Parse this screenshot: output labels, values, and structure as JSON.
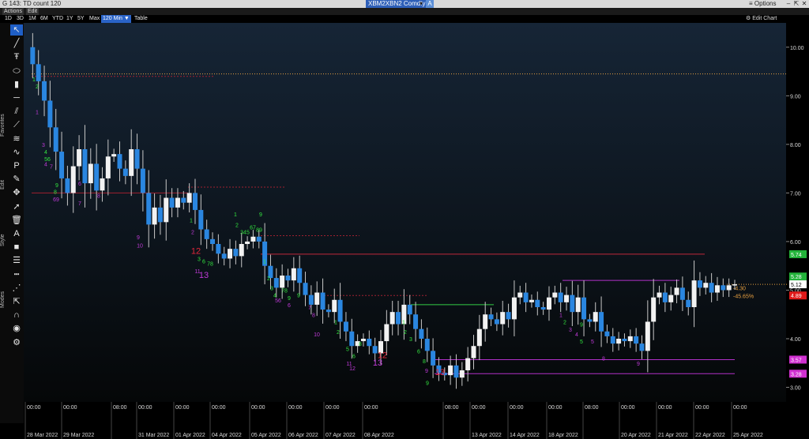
{
  "window": {
    "title": "G 143: TD count 120",
    "ticker": "XBM2XBN2 Comdty",
    "ticker_dropdown": "▾",
    "ticker_badge": "A",
    "options_label": "Options",
    "minimize": "–",
    "maximize": "⇱",
    "close": "✕"
  },
  "menu": {
    "actions": "Actions",
    "edit": "Edit"
  },
  "ranges": [
    "1D",
    "3D",
    "1M",
    "6M",
    "YTD",
    "1Y",
    "5Y",
    "Max"
  ],
  "interval": "120 Min",
  "interval_dropdown": "▼",
  "table_label": "Table",
  "edit_chart_label": "Edit Chart",
  "settings_glyph": "⚙",
  "toolbar": {
    "groups": [
      "Favorites",
      "Edit",
      "Style",
      "Modes"
    ],
    "tools": [
      {
        "icon": "cursor-arrow-icon",
        "glyph": "↖",
        "active": true
      },
      {
        "icon": "pen-line-icon",
        "glyph": "╱"
      },
      {
        "icon": "text-percent-icon",
        "glyph": "Ŧ"
      },
      {
        "icon": "ellipse-icon",
        "glyph": "⬭"
      },
      {
        "icon": "candle-icon",
        "glyph": "▮"
      },
      {
        "icon": "horizontal-line-icon",
        "glyph": "─"
      },
      {
        "icon": "parallel-lines-icon",
        "glyph": "⫽"
      },
      {
        "icon": "segment-icon",
        "glyph": "⟋"
      },
      {
        "icon": "channel-icon",
        "glyph": "≋"
      },
      {
        "icon": "trend-icon",
        "glyph": "∿"
      },
      {
        "icon": "p-marker-icon",
        "glyph": "P"
      },
      {
        "icon": "pencil-icon",
        "glyph": "✎"
      },
      {
        "icon": "move-icon",
        "glyph": "✥"
      },
      {
        "icon": "select-arrow-icon",
        "glyph": "➚"
      },
      {
        "icon": "trash-icon",
        "glyph": "🗑"
      },
      {
        "icon": "font-a-icon",
        "glyph": "A"
      },
      {
        "icon": "fill-square-icon",
        "glyph": "■"
      },
      {
        "icon": "line-weight-icon",
        "glyph": "☰"
      },
      {
        "icon": "dash-style-icon",
        "glyph": "┅"
      },
      {
        "icon": "crosshair-icon",
        "glyph": "⋰"
      },
      {
        "icon": "pointer-icon",
        "glyph": "⇱"
      },
      {
        "icon": "magnet-icon",
        "glyph": "∩"
      },
      {
        "icon": "globe-icon",
        "glyph": "◉"
      },
      {
        "icon": "gear-icon",
        "glyph": "⚙"
      }
    ]
  },
  "colors": {
    "bg_top": "#162536",
    "bg_bottom": "#050708",
    "up_candle": "#f2f2f2",
    "down_candle": "#2a86e0",
    "wick": "#c8c8c8",
    "setup_green": "#33e63f",
    "setup_magenta": "#c03ad8",
    "countdown_red": "#e0263a",
    "axis_text": "#d8d8d8"
  },
  "chart_data": {
    "type": "candlestick",
    "ylim": [
      2.7,
      10.5
    ],
    "y_ticks": [
      3.0,
      4.0,
      5.0,
      6.0,
      7.0,
      8.0,
      9.0,
      10.0
    ],
    "x_time_labels": [
      "00:00",
      "00:00",
      "08:00",
      "00:00",
      "00:00",
      "00:00",
      "00:00",
      "00:00",
      "00:00",
      "00:00",
      "08:00",
      "00:00",
      "00:00",
      "00:00",
      "08:00",
      "00:00",
      "00:00",
      "00:00",
      "00:00"
    ],
    "x_date_labels": [
      "28 Mar 2022",
      "29 Mar 2022",
      "",
      "31 Mar 2022",
      "01 Apr 2022",
      "04 Apr 2022",
      "05 Apr 2022",
      "06 Apr 2022",
      "07 Apr 2022",
      "08 Apr 2022",
      "",
      "13 Apr 2022",
      "14 Apr 2022",
      "18 Apr 2022",
      "",
      "20 Apr 2022",
      "21 Apr 2022",
      "22 Apr 2022",
      "25 Apr 2022"
    ],
    "close_path": [
      10.0,
      9.65,
      9.3,
      8.9,
      8.35,
      7.85,
      7.3,
      7.0,
      7.55,
      7.9,
      7.2,
      7.6,
      7.05,
      7.3,
      7.75,
      7.8,
      7.5,
      7.35,
      7.9,
      7.5,
      7.0,
      6.35,
      6.7,
      6.4,
      6.9,
      6.7,
      6.9,
      6.8,
      7.0,
      6.65,
      6.25,
      6.05,
      5.95,
      5.75,
      5.65,
      5.85,
      5.7,
      5.95,
      6.0,
      6.1,
      6.0,
      5.5,
      5.25,
      5.05,
      5.3,
      5.2,
      5.45,
      5.15,
      4.9,
      4.7,
      4.95,
      4.6,
      4.55,
      4.8,
      4.35,
      4.15,
      3.85,
      3.95,
      4.0,
      3.85,
      3.7,
      3.95,
      4.3,
      4.55,
      4.3,
      4.7,
      4.5,
      4.2,
      4.0,
      3.75,
      3.45,
      3.3,
      3.25,
      3.45,
      3.2,
      3.35,
      3.6,
      3.85,
      4.2,
      4.5,
      4.4,
      4.3,
      4.55,
      4.4,
      4.85,
      4.95,
      4.75,
      4.8,
      4.65,
      4.6,
      4.85,
      4.95,
      4.75,
      4.9,
      4.55,
      4.85,
      4.4,
      4.35,
      4.55,
      4.15,
      4.05,
      3.9,
      4.0,
      3.95,
      4.05,
      3.9,
      3.75,
      4.35,
      4.85,
      4.95,
      4.75,
      4.9,
      5.05,
      4.8,
      4.65,
      5.2,
      5.05,
      5.15,
      4.95,
      5.1,
      5.0,
      5.1,
      5.12
    ],
    "series": [
      {
        "name": "XBM2XBN2 Comdty"
      }
    ],
    "td_setup_labels": [
      {
        "x": 43,
        "y": 9.3,
        "text": "1",
        "color": "green"
      },
      {
        "x": 47,
        "y": 9.15,
        "text": "2",
        "color": "green"
      },
      {
        "x": 47,
        "y": 8.62,
        "text": "1",
        "color": "magenta"
      },
      {
        "x": 55,
        "y": 7.95,
        "text": "3",
        "color": "magenta"
      },
      {
        "x": 58,
        "y": 7.8,
        "text": "4",
        "color": "green"
      },
      {
        "x": 60,
        "y": 7.66,
        "text": "56",
        "color": "green"
      },
      {
        "x": 58,
        "y": 7.55,
        "text": "4",
        "color": "magenta"
      },
      {
        "x": 65,
        "y": 7.5,
        "text": "7",
        "color": "magenta"
      },
      {
        "x": 72,
        "y": 7.12,
        "text": "9",
        "color": "green"
      },
      {
        "x": 70,
        "y": 6.98,
        "text": "8",
        "color": "green"
      },
      {
        "x": 71,
        "y": 6.83,
        "text": "69",
        "color": "magenta"
      },
      {
        "x": 101,
        "y": 7.15,
        "text": "6",
        "color": "magenta"
      },
      {
        "x": 101,
        "y": 6.75,
        "text": "7",
        "color": "magenta"
      },
      {
        "x": 125,
        "y": 6.9,
        "text": "8",
        "color": "magenta"
      },
      {
        "x": 175,
        "y": 6.05,
        "text": "9",
        "color": "magenta"
      },
      {
        "x": 177,
        "y": 5.88,
        "text": "10",
        "color": "magenta"
      },
      {
        "x": 242,
        "y": 6.4,
        "text": "1",
        "color": "green"
      },
      {
        "x": 244,
        "y": 6.15,
        "text": "2",
        "color": "magenta"
      },
      {
        "x": 248,
        "y": 5.75,
        "text": "12",
        "color": "red"
      },
      {
        "x": 252,
        "y": 5.6,
        "text": "3",
        "color": "green"
      },
      {
        "x": 258,
        "y": 5.55,
        "text": "6",
        "color": "green"
      },
      {
        "x": 250,
        "y": 5.35,
        "text": "11",
        "color": "magenta"
      },
      {
        "x": 258,
        "y": 5.25,
        "text": "13",
        "color": "magenta"
      },
      {
        "x": 266,
        "y": 5.5,
        "text": "78",
        "color": "green"
      },
      {
        "x": 298,
        "y": 6.52,
        "text": "1",
        "color": "green"
      },
      {
        "x": 300,
        "y": 6.3,
        "text": "2",
        "color": "green"
      },
      {
        "x": 310,
        "y": 6.15,
        "text": "345",
        "color": "green"
      },
      {
        "x": 320,
        "y": 6.25,
        "text": "67",
        "color": "green"
      },
      {
        "x": 328,
        "y": 6.2,
        "text": "89",
        "color": "green"
      },
      {
        "x": 330,
        "y": 6.52,
        "text": "9",
        "color": "green"
      },
      {
        "x": 335,
        "y": 5.55,
        "text": "1",
        "color": "green"
      },
      {
        "x": 340,
        "y": 5.2,
        "text": "2",
        "color": "green"
      },
      {
        "x": 344,
        "y": 5.0,
        "text": "3",
        "color": "green"
      },
      {
        "x": 348,
        "y": 4.85,
        "text": "4",
        "color": "green"
      },
      {
        "x": 352,
        "y": 4.75,
        "text": "56",
        "color": "magenta"
      },
      {
        "x": 360,
        "y": 4.95,
        "text": "78",
        "color": "green"
      },
      {
        "x": 366,
        "y": 4.8,
        "text": "9",
        "color": "green"
      },
      {
        "x": 366,
        "y": 4.65,
        "text": "6",
        "color": "magenta"
      },
      {
        "x": 378,
        "y": 4.85,
        "text": "9",
        "color": "green"
      },
      {
        "x": 392,
        "y": 4.6,
        "text": "7",
        "color": "magenta"
      },
      {
        "x": 397,
        "y": 4.45,
        "text": "8",
        "color": "magenta"
      },
      {
        "x": 401,
        "y": 4.05,
        "text": "10",
        "color": "magenta"
      },
      {
        "x": 425,
        "y": 4.3,
        "text": "1",
        "color": "green"
      },
      {
        "x": 428,
        "y": 4.1,
        "text": "2",
        "color": "green"
      },
      {
        "x": 440,
        "y": 3.75,
        "text": "5",
        "color": "green"
      },
      {
        "x": 448,
        "y": 3.6,
        "text": "6",
        "color": "green"
      },
      {
        "x": 442,
        "y": 3.45,
        "text": "11",
        "color": "magenta"
      },
      {
        "x": 446,
        "y": 3.35,
        "text": "12",
        "color": "magenta"
      },
      {
        "x": 456,
        "y": 3.85,
        "text": "8",
        "color": "green"
      },
      {
        "x": 478,
        "y": 3.45,
        "text": "13",
        "color": "magenta"
      },
      {
        "x": 484,
        "y": 3.6,
        "text": "12",
        "color": "red"
      },
      {
        "x": 511,
        "y": 4.3,
        "text": "1",
        "color": "green"
      },
      {
        "x": 513,
        "y": 4.1,
        "text": "2",
        "color": "green"
      },
      {
        "x": 520,
        "y": 3.95,
        "text": "3",
        "color": "green"
      },
      {
        "x": 530,
        "y": 3.7,
        "text": "6",
        "color": "green"
      },
      {
        "x": 537,
        "y": 3.5,
        "text": "8",
        "color": "green"
      },
      {
        "x": 541,
        "y": 3.05,
        "text": "9",
        "color": "green"
      },
      {
        "x": 557,
        "y": 3.25,
        "text": "13",
        "color": "red"
      },
      {
        "x": 540,
        "y": 3.3,
        "text": "9",
        "color": "magenta"
      },
      {
        "x": 710,
        "y": 4.45,
        "text": "1",
        "color": "magenta"
      },
      {
        "x": 715,
        "y": 4.3,
        "text": "2",
        "color": "green"
      },
      {
        "x": 722,
        "y": 4.15,
        "text": "3",
        "color": "magenta"
      },
      {
        "x": 730,
        "y": 4.05,
        "text": "4",
        "color": "magenta"
      },
      {
        "x": 736,
        "y": 3.9,
        "text": "5",
        "color": "green"
      },
      {
        "x": 736,
        "y": 4.25,
        "text": "9",
        "color": "green"
      },
      {
        "x": 750,
        "y": 3.9,
        "text": "5",
        "color": "magenta"
      },
      {
        "x": 764,
        "y": 3.55,
        "text": "8",
        "color": "magenta"
      },
      {
        "x": 808,
        "y": 3.45,
        "text": "9",
        "color": "magenta"
      }
    ],
    "levels": [
      {
        "value": 9.45,
        "x_start": 40,
        "x_end": 996,
        "color": "#e8a040",
        "style": "dotted"
      },
      {
        "value": 9.4,
        "x_start": 40,
        "x_end": 272,
        "color": "#a02030",
        "style": "dashed"
      },
      {
        "value": 7.12,
        "x_start": 238,
        "x_end": 362,
        "color": "#a02030",
        "style": "dashed"
      },
      {
        "value": 7.0,
        "x_start": 40,
        "x_end": 238,
        "color": "#a02030",
        "style": "solid"
      },
      {
        "value": 6.12,
        "x_start": 330,
        "x_end": 455,
        "color": "#a02030",
        "style": "dashed"
      },
      {
        "value": 5.74,
        "x_start": 330,
        "x_end": 892,
        "color": "#c0283a",
        "style": "solid"
      },
      {
        "value": 5.12,
        "x_start": 920,
        "x_end": 996,
        "color": "#e8a040",
        "style": "dotted"
      },
      {
        "value": 4.89,
        "x_start": 410,
        "x_end": 540,
        "color": "#a02030",
        "style": "dashed"
      },
      {
        "value": 4.7,
        "x_start": 520,
        "x_end": 625,
        "color": "#33cc44",
        "style": "solid"
      },
      {
        "value": 3.57,
        "x_start": 550,
        "x_end": 930,
        "color": "#b030c8",
        "style": "solid"
      },
      {
        "value": 3.28,
        "x_start": 550,
        "x_end": 930,
        "color": "#b030c8",
        "style": "solid"
      },
      {
        "value": 5.2,
        "x_start": 712,
        "x_end": 860,
        "color": "#b030c8",
        "style": "solid"
      }
    ],
    "price_tags": [
      {
        "value": 5.74,
        "label": "5.74",
        "bg": "#23b33a",
        "fg": "#ffffff"
      },
      {
        "value": 5.28,
        "label": "5.28",
        "bg": "#23b33a",
        "fg": "#ffffff"
      },
      {
        "value": 5.12,
        "label": "5.12",
        "bg": "#ffffff",
        "fg": "#000000"
      },
      {
        "value": 4.89,
        "label": "4.89",
        "bg": "#e01a1a",
        "fg": "#ffffff"
      },
      {
        "value": 3.57,
        "label": "3.57",
        "bg": "#d030d0",
        "fg": "#ffffff"
      },
      {
        "value": 3.28,
        "label": "3.28",
        "bg": "#d030d0",
        "fg": "#ffffff"
      }
    ],
    "annotations": [
      {
        "text": "-4.30",
        "color": "#e8a040",
        "value": 5.0
      },
      {
        "text": "-45.65%",
        "color": "#e8a040",
        "value": 4.84
      }
    ]
  }
}
